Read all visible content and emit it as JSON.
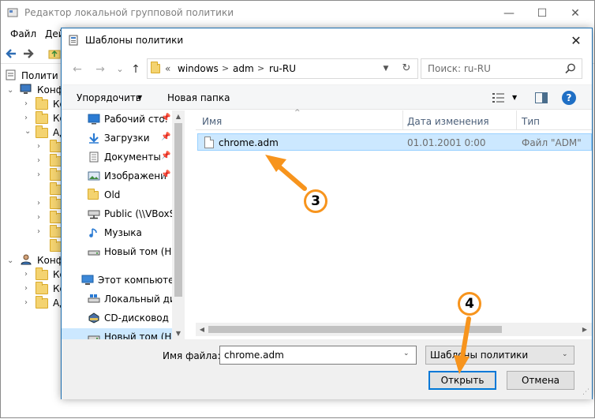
{
  "background_window": {
    "title": "Редактор локальной групповой политики",
    "menu": [
      "Файл",
      "Дей"
    ],
    "tree": {
      "root": "Полити",
      "computer_config": "Конф",
      "items_k": [
        "Ко",
        "Ко"
      ],
      "admin": "Ад",
      "user_config": "Конф",
      "user_items": [
        "Ко",
        "Ко",
        "Ад"
      ]
    }
  },
  "dialog": {
    "title": "Шаблоны политики",
    "close_glyph": "✕",
    "nav": {
      "back": "←",
      "forward": "→",
      "recent": "⌄",
      "up": "↑"
    },
    "address": {
      "overflow": "«",
      "crumbs": [
        "windows",
        "adm",
        "ru-RU"
      ],
      "separator": ">"
    },
    "search": {
      "placeholder": "Поиск: ru-RU"
    },
    "commands": {
      "organize": "Упорядочить",
      "new_folder": "Новая папка",
      "help": "?"
    },
    "nav_pane": [
      {
        "label": "Рабочий сто.",
        "icon": "desktop-icon",
        "pinned": true
      },
      {
        "label": "Загрузки",
        "icon": "download-icon",
        "pinned": true
      },
      {
        "label": "Документы",
        "icon": "documents-icon",
        "pinned": true
      },
      {
        "label": "Изображени",
        "icon": "pictures-icon",
        "pinned": true
      },
      {
        "label": "Old",
        "icon": "folder-icon",
        "pinned": false
      },
      {
        "label": "Public (\\\\VBoxSv",
        "icon": "network-drive-icon",
        "pinned": false
      },
      {
        "label": "Музыка",
        "icon": "music-icon",
        "pinned": false
      },
      {
        "label": "Новый том (H:)",
        "icon": "drive-icon",
        "pinned": false
      },
      {
        "label": "Этот компьютер",
        "icon": "computer-icon",
        "pinned": false
      },
      {
        "label": "Локальный дис",
        "icon": "drive-icon",
        "pinned": false
      },
      {
        "label": "CD-дисковод (E",
        "icon": "cd-drive-icon",
        "pinned": false
      },
      {
        "label": "Новый том (H:)",
        "icon": "drive-icon",
        "pinned": false
      }
    ],
    "columns": {
      "name": "Имя",
      "date": "Дата изменения",
      "type": "Тип"
    },
    "files": [
      {
        "name": "chrome.adm",
        "date": "01.01.2001 0:00",
        "type": "Файл \"ADM\""
      }
    ],
    "bottom": {
      "filename_label": "Имя файла:",
      "filename_value": "chrome.adm",
      "filetype_value": "Шаблоны политики",
      "open_label": "Открыть",
      "cancel_label": "Отмена"
    }
  },
  "annotations": {
    "step3": "3",
    "step4": "4",
    "color": "#f7941d"
  }
}
